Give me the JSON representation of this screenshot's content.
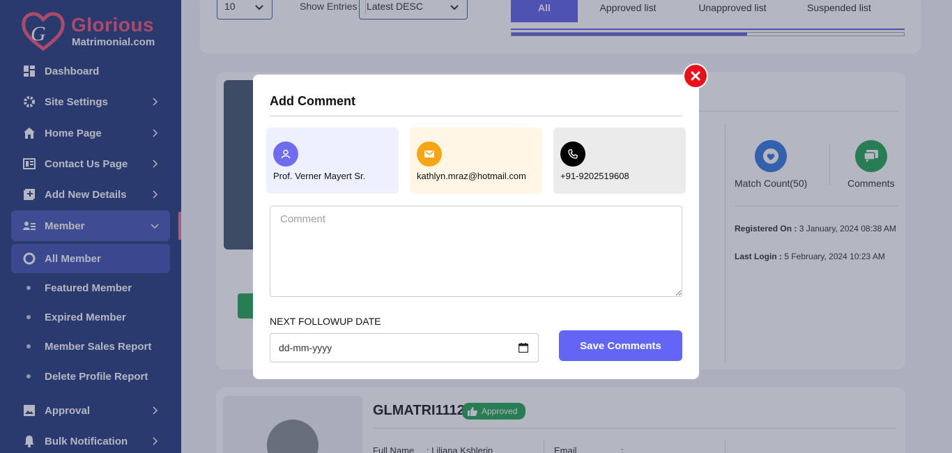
{
  "brand": {
    "name_line1": "Glorious",
    "name_line2": "Matrimonial.com",
    "colors": {
      "sidebar": "#2c3e7e",
      "accent": "#6366e8",
      "logo_pink": "#f05a7a"
    }
  },
  "sidebar": {
    "items": [
      {
        "label": "Dashboard",
        "icon": "dashboard-icon",
        "has_chevron": false
      },
      {
        "label": "Site Settings",
        "icon": "gear-icon",
        "has_chevron": true
      },
      {
        "label": "Home Page",
        "icon": "home-icon",
        "has_chevron": true
      },
      {
        "label": "Contact Us Page",
        "icon": "contact-card-icon",
        "has_chevron": true
      },
      {
        "label": "Add New Details",
        "icon": "add-box-icon",
        "has_chevron": true
      },
      {
        "label": "Member",
        "icon": "member-list-icon",
        "expanded": true
      },
      {
        "label": "All Member",
        "icon": "radio-circle-icon",
        "selected": true
      },
      {
        "label": "Featured Member"
      },
      {
        "label": "Expired Member"
      },
      {
        "label": "Member Sales Report"
      },
      {
        "label": "Delete Profile Report"
      },
      {
        "label": "Approval",
        "icon": "image-icon",
        "has_chevron": true
      },
      {
        "label": "Bulk Notification",
        "icon": "bell-icon",
        "has_chevron": true
      }
    ]
  },
  "filters": {
    "entries_value": "10",
    "show_entries_label": "Show Entries",
    "sort_value": "Latest DESC"
  },
  "tabs": [
    {
      "label": "All",
      "active": true
    },
    {
      "label": "Approved list"
    },
    {
      "label": "Unapproved list"
    },
    {
      "label": "Suspended list"
    }
  ],
  "member_card": {
    "match_count_label": "Match Count(50)",
    "comments_label": "Comments",
    "registered_label": "Registered On :",
    "registered_value": "3 January, 2024 08:38 AM",
    "last_login_label": "Last Login :",
    "last_login_value": "5 February, 2024 10:23 AM"
  },
  "member_card2": {
    "id": "GLMATRI1112",
    "status": "Approved",
    "full_name_label": "Full Name",
    "full_name_value": ": Liliana Kshlerin",
    "email_label": "Email",
    "email_value": ":"
  },
  "modal": {
    "title": "Add Comment",
    "name": "Prof. Verner Mayert Sr.",
    "email": "kathlyn.mraz@hotmail.com",
    "phone": "+91-9202519608",
    "comment_placeholder": "Comment",
    "followup_label": "NEXT FOLLOWUP DATE",
    "date_placeholder": "dd-mm-yyyy",
    "save_label": "Save Comments",
    "colors": {
      "name_card": "#eef0fd",
      "email_card": "#fff6e6",
      "phone_card": "#ebebeb",
      "save": "#6366f5",
      "close": "#e8101b"
    }
  }
}
